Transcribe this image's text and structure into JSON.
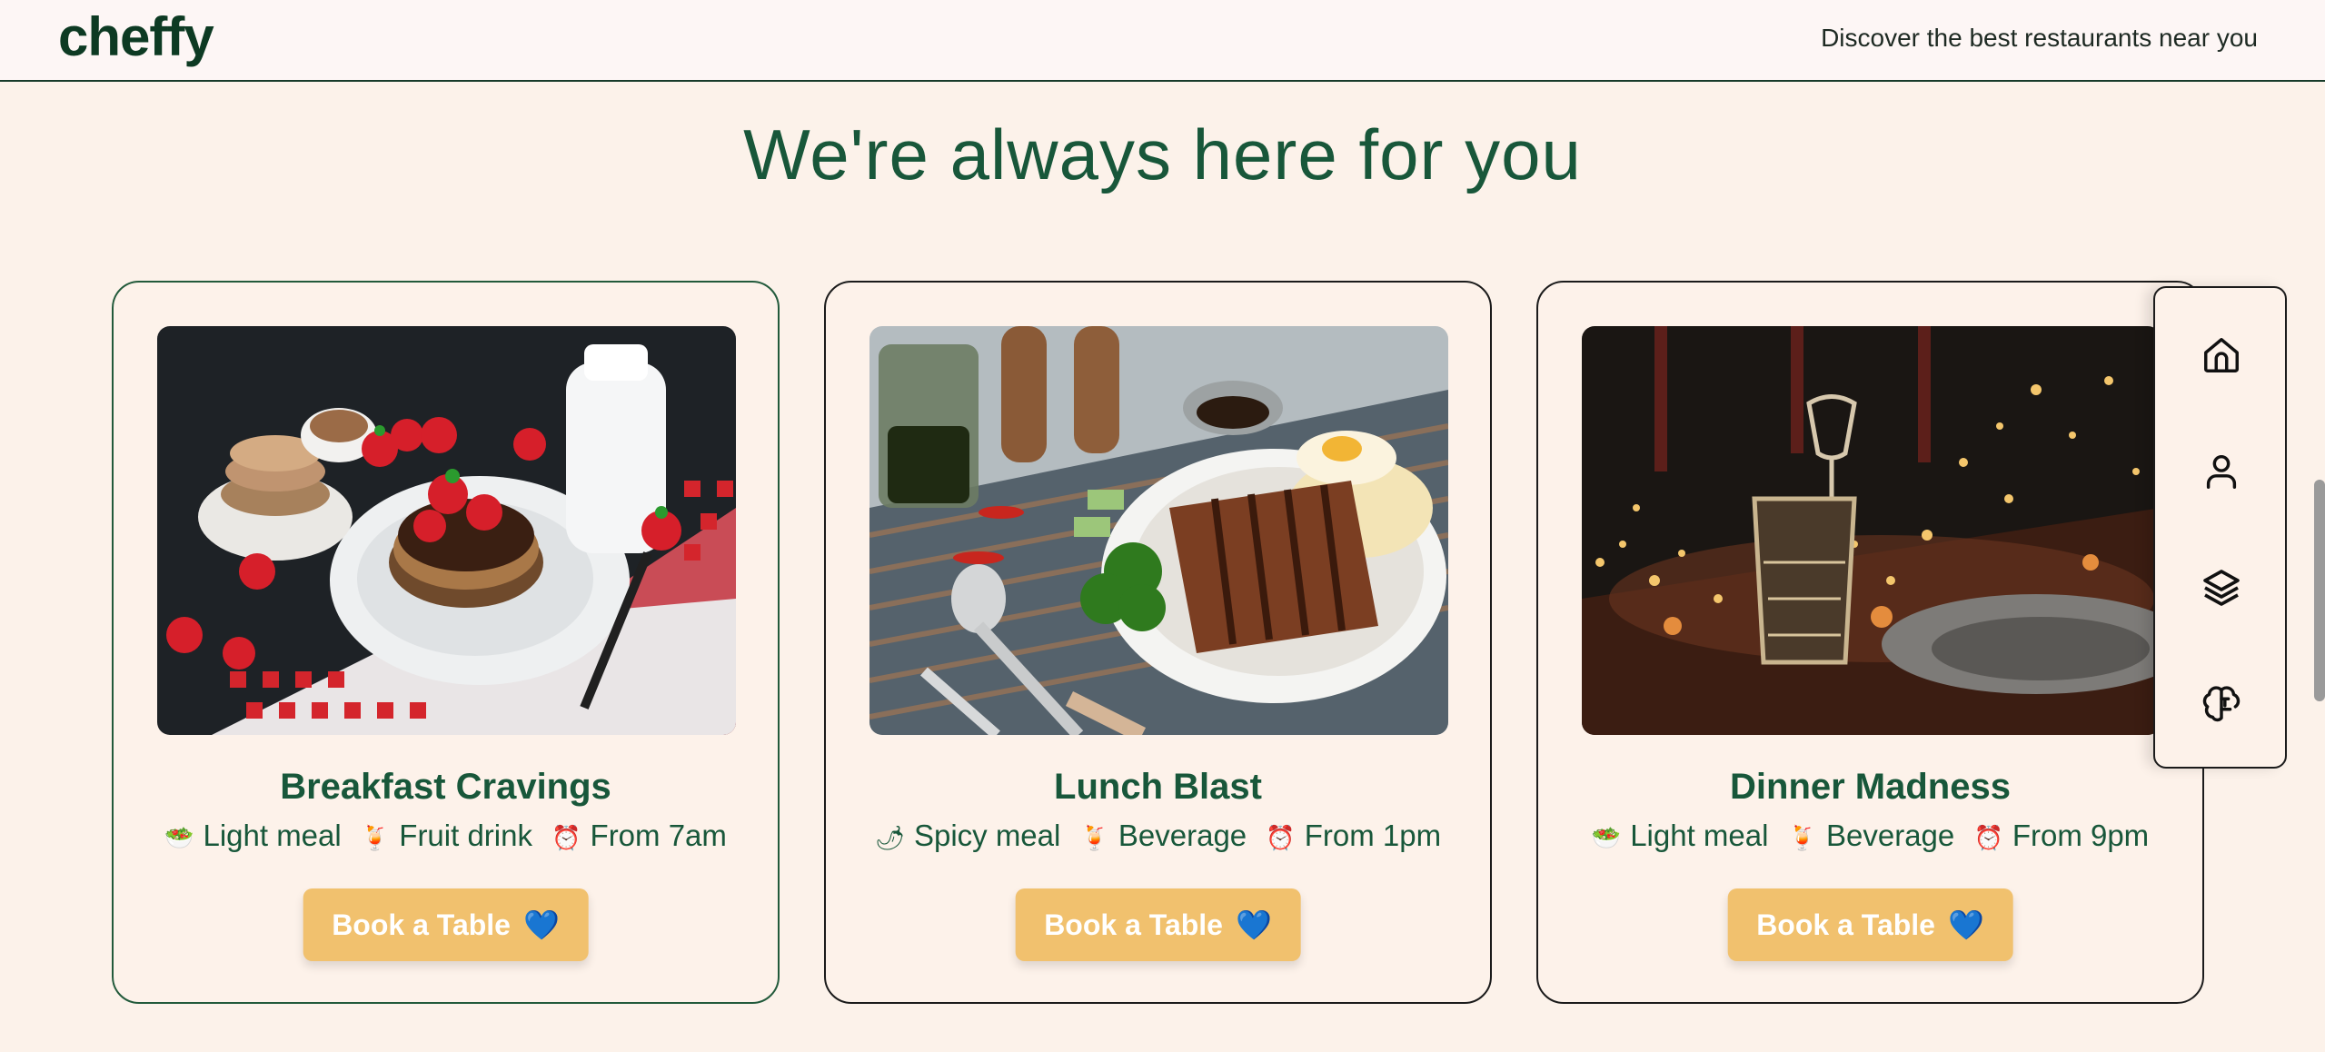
{
  "header": {
    "logo": "cheffy",
    "tagline": "Discover the best restaurants near you"
  },
  "page_title": "We're always here for you",
  "cards": [
    {
      "title": "Breakfast Cravings",
      "tags": [
        {
          "emoji": "🥗",
          "text": "Light meal"
        },
        {
          "emoji": "🍹",
          "text": "Fruit drink"
        },
        {
          "emoji": "⏰",
          "text": "From 7am"
        }
      ],
      "button": "Book a Table",
      "button_emoji": "💙"
    },
    {
      "title": "Lunch Blast",
      "tags": [
        {
          "emoji": "🌶",
          "text": "Spicy meal"
        },
        {
          "emoji": "🍹",
          "text": "Beverage"
        },
        {
          "emoji": "⏰",
          "text": "From 1pm"
        }
      ],
      "button": "Book a Table",
      "button_emoji": "💙"
    },
    {
      "title": "Dinner Madness",
      "tags": [
        {
          "emoji": "🥗",
          "text": "Light meal"
        },
        {
          "emoji": "🍹",
          "text": "Beverage"
        },
        {
          "emoji": "⏰",
          "text": "From 9pm"
        }
      ],
      "button": "Book a Table",
      "button_emoji": "💙"
    }
  ],
  "sidenav": [
    "home-icon",
    "user-icon",
    "layers-icon",
    "brain-icon"
  ],
  "colors": {
    "background": "#fcf2ea",
    "primary_green": "#18573a",
    "button": "#f1c16e"
  }
}
